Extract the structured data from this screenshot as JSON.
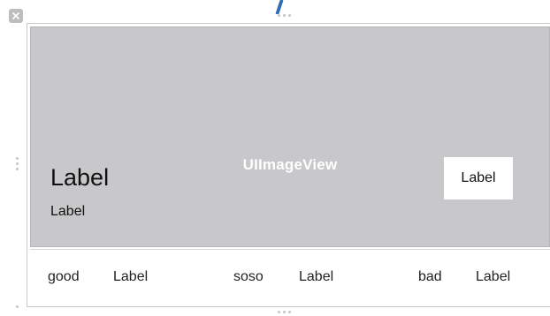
{
  "image_view": {
    "title": "UIImageView",
    "big_label": "Label",
    "small_label": "Label",
    "box_label": "Label"
  },
  "rating_row": {
    "items": [
      {
        "name": "good",
        "value": "Label"
      },
      {
        "name": "soso",
        "value": "Label"
      },
      {
        "name": "bad",
        "value": "Label"
      }
    ]
  },
  "icons": {
    "close": "close-icon",
    "resize_handle": "resize-handle-icon"
  },
  "colors": {
    "image_view_bg": "#c8c8ca",
    "accent_line": "#2f6db5"
  }
}
